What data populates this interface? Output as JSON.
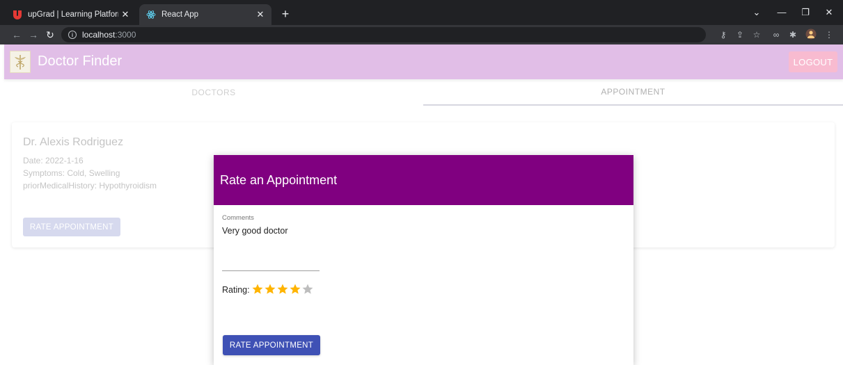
{
  "browser": {
    "tabs": [
      {
        "title": "upGrad | Learning Platform",
        "icon": "upgrad-favicon",
        "active": false
      },
      {
        "title": "React App",
        "icon": "react-favicon",
        "active": true
      }
    ],
    "address": {
      "host": "localhost",
      "port": ":3000"
    }
  },
  "app": {
    "title": "Doctor Finder",
    "logout_label": "LOGOUT",
    "tabs": [
      {
        "label": "DOCTORS"
      },
      {
        "label": "APPOINTMENT"
      }
    ]
  },
  "appointment_card": {
    "doctor_name": "Dr. Alexis Rodriguez",
    "date": "Date: 2022-1-16",
    "symptoms": "Symptoms: Cold, Swelling",
    "history": "priorMedicalHistory: Hypothyroidism",
    "button_label": "RATE APPOINTMENT"
  },
  "modal": {
    "title": "Rate an Appointment",
    "comments_label": "Comments",
    "comments_value": "Very good doctor",
    "rating_label": "Rating:",
    "rating": 4,
    "rating_max": 5,
    "submit_label": "RATE APPOINTMENT"
  },
  "colors": {
    "appbar": "#e1bee7",
    "modal_header": "#800080",
    "primary_button": "#3f51b5",
    "star_filled": "#ffb400",
    "star_empty": "#bdbdbd"
  }
}
